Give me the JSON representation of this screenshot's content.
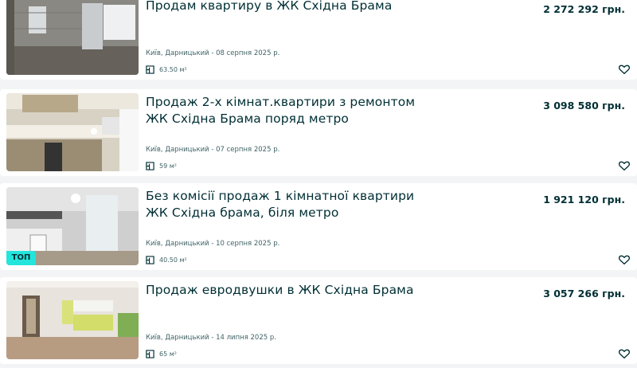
{
  "listings": [
    {
      "title": "Продам квартиру в ЖК Східна Брама",
      "price": "2 272 292 грн.",
      "location_date": "Київ, Дарницький - 08 серпня 2025 р.",
      "area": "63.50 м²",
      "badge": ""
    },
    {
      "title": "Продаж 2-х кімнат.квартири з ремонтом ЖК Східна Брама поряд метро",
      "price": "3 098 580 грн.",
      "location_date": "Київ, Дарницький - 07 серпня 2025 р.",
      "area": "59 м²",
      "badge": ""
    },
    {
      "title": "Без комісії продаж 1 кімнатної квартири ЖК Східна брама, біля метро",
      "price": "1 921 120 грн.",
      "location_date": "Київ, Дарницький - 10 серпня 2025 р.",
      "area": "40.50 м²",
      "badge": "ТОП"
    },
    {
      "title": "Продаж евродвушки в ЖК Східна Брама",
      "price": "3 057 266 грн.",
      "location_date": "Київ, Дарницький - 14 липня 2025 р.",
      "area": "65 м²",
      "badge": ""
    }
  ],
  "icons": {
    "area": "floor-plan-icon",
    "favorite": "heart-icon"
  },
  "colors": {
    "text": "#002f34",
    "meta": "#406367",
    "badge": "#23e5db",
    "background": "#f2f4f5"
  }
}
